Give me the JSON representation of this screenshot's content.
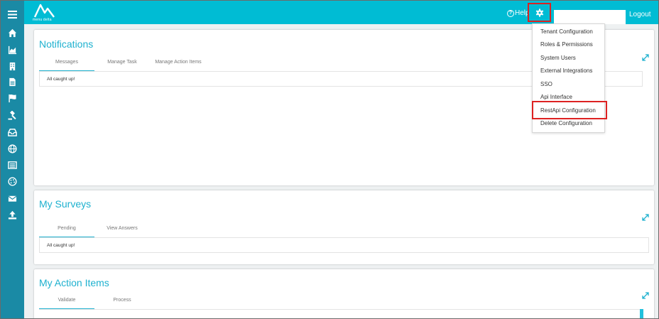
{
  "header": {
    "logo_text": "menu delta",
    "help_label": "Help",
    "logout_label": "Logout"
  },
  "sidebar": {
    "items": [
      {
        "icon": "home-icon"
      },
      {
        "icon": "chart-icon"
      },
      {
        "icon": "building-icon"
      },
      {
        "icon": "document-icon"
      },
      {
        "icon": "flag-icon"
      },
      {
        "icon": "gavel-icon"
      },
      {
        "icon": "inbox-icon"
      },
      {
        "icon": "globe-icon"
      },
      {
        "icon": "list-icon"
      },
      {
        "icon": "palette-icon"
      },
      {
        "icon": "envelope-icon"
      },
      {
        "icon": "upload-icon"
      }
    ]
  },
  "settings_menu": {
    "items": [
      "Tenant Configuration",
      "Roles & Permissions",
      "System Users",
      "External Integrations",
      "SSO",
      "Api Interface",
      "RestApi Configuration",
      "Delete Configuration"
    ],
    "highlighted": "RestApi Configuration"
  },
  "notifications": {
    "title": "Notifications",
    "tabs": [
      "Messages",
      "Manage Task",
      "Manage Action Items"
    ],
    "active_tab": "Messages",
    "content": "All caught up!"
  },
  "surveys": {
    "title": "My Surveys",
    "tabs": [
      "Pending",
      "View Answers"
    ],
    "active_tab": "Pending",
    "content": "All caught up!"
  },
  "action_items": {
    "title": "My Action Items",
    "tabs": [
      "Validate",
      "Process"
    ],
    "active_tab": "Validate"
  },
  "colors": {
    "topbar": "#00bcd4",
    "sidebar": "#1a8aa5",
    "accent": "#1eb1cf",
    "highlight_box": "#dd2222"
  }
}
